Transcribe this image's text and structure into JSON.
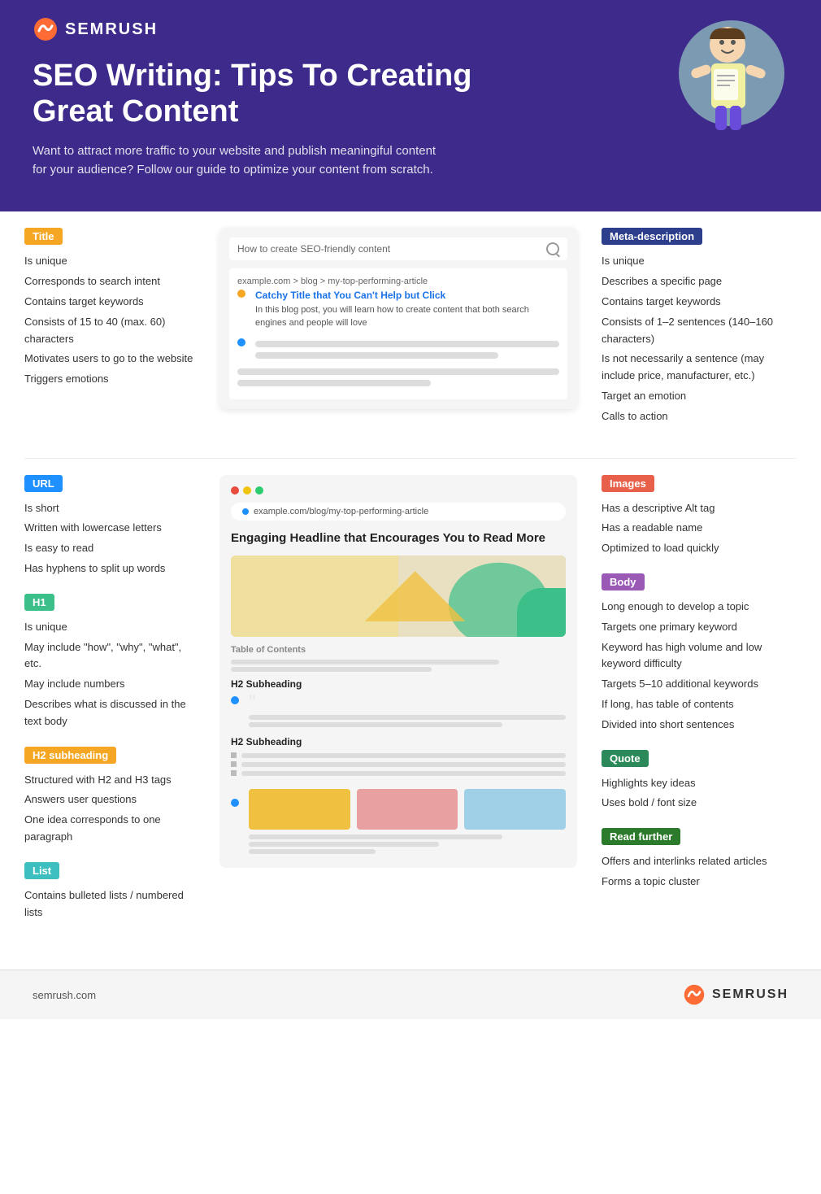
{
  "header": {
    "logo_text": "SEMRUSH",
    "title": "SEO Writing: Tips To Creating Great Content",
    "subtitle": "Want to attract more traffic to your website and publish meaningiful content for your audience? Follow our guide to optimize your content from scratch."
  },
  "title_section": {
    "label": "Title",
    "items": [
      "Is unique",
      "Corresponds to search intent",
      "Contains target keywords",
      "Consists of 15 to 40 (max. 60) characters",
      "Motivates users to go to the website",
      "Triggers emotions"
    ]
  },
  "meta_section": {
    "label": "Meta-description",
    "items": [
      "Is unique",
      "Describes a specific page",
      "Contains target keywords",
      "Consists of 1–2 sentences (140–160 characters)",
      "Is not necessarily a sentence (may include price, manufacturer, etc.)",
      "Target an emotion",
      "Calls to action"
    ]
  },
  "browser": {
    "search_placeholder": "How to create SEO-friendly content",
    "breadcrumb": "example.com > blog > my-top-performing-article",
    "title_link": "Catchy Title that You Can't Help but Click",
    "description": "In this blog post, you will learn how to create content that both search engines and people will love"
  },
  "url_section": {
    "label": "URL",
    "items": [
      "Is short",
      "Written with lowercase letters",
      "Is easy to read",
      "Has hyphens to split up words"
    ]
  },
  "h1_section": {
    "label": "H1",
    "items": [
      "Is unique",
      "May include \"how\", \"why\", \"what\", etc.",
      "May include numbers",
      "Describes what is discussed in the text body"
    ]
  },
  "h2_section": {
    "label": "H2 subheading",
    "items": [
      "Structured with H2 and H3 tags",
      "Answers user questions",
      "One idea corresponds to one paragraph"
    ]
  },
  "list_section": {
    "label": "List",
    "items": [
      "Contains bulleted lists / numbered lists"
    ]
  },
  "images_section": {
    "label": "Images",
    "items": [
      "Has a descriptive Alt tag",
      "Has a readable name",
      "Optimized to load quickly"
    ]
  },
  "body_section": {
    "label": "Body",
    "items": [
      "Long enough to develop a topic",
      "Targets one primary keyword",
      "Keyword has high volume and low keyword difficulty",
      "Targets 5–10 additional keywords",
      "If long, has table of contents",
      "Divided into short sentences"
    ]
  },
  "quote_section": {
    "label": "Quote",
    "items": [
      "Highlights key ideas",
      "Uses bold / font size"
    ]
  },
  "read_further_section": {
    "label": "Read further",
    "items": [
      "Offers and interlinks related articles",
      "Forms a topic cluster"
    ]
  },
  "article": {
    "url": "example.com/blog/my-top-performing-article",
    "headline": "Engaging Headline that Encourages You to Read More",
    "toc_label": "Table of Contents",
    "h2_label_1": "H2 Subheading",
    "h2_label_2": "H2 Subheading"
  },
  "footer": {
    "url": "semrush.com",
    "logo_text": "SEMRUSH"
  }
}
